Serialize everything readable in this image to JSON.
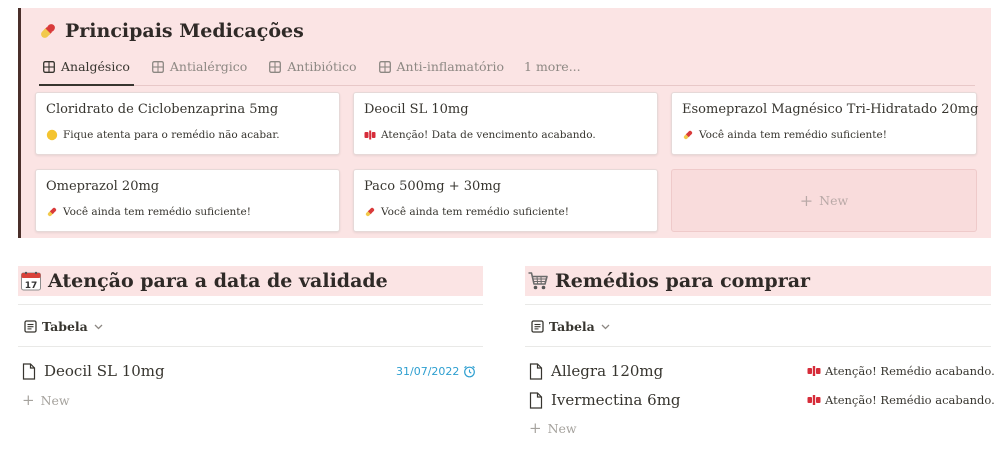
{
  "callout": {
    "title": "Principais Medicações",
    "tabs": [
      {
        "label": "Analgésico",
        "active": true
      },
      {
        "label": "Antialérgico",
        "active": false
      },
      {
        "label": "Antibiótico",
        "active": false
      },
      {
        "label": "Anti-inflamatório",
        "active": false
      }
    ],
    "more_label": "1 more...",
    "cards": [
      {
        "title": "Cloridrato de Ciclobenzaprina 5mg",
        "status": "Fique atenta para o remédio não acabar.",
        "status_icon": "yellow-circle-icon"
      },
      {
        "title": "Deocil SL 10mg",
        "status": "Atenção! Data de vencimento acabando.",
        "status_icon": "red-pills-icon"
      },
      {
        "title": "Esomeprazol Magnésico Tri-Hidratado 20mg",
        "status": "Você ainda tem remédio suficiente!",
        "status_icon": "pill-icon"
      },
      {
        "title": "Omeprazol 20mg",
        "status": "Você ainda tem remédio suficiente!",
        "status_icon": "pill-icon"
      },
      {
        "title": "Paco 500mg + 30mg",
        "status": "Você ainda tem remédio suficiente!",
        "status_icon": "pill-icon"
      }
    ],
    "new_card_label": "New"
  },
  "validade": {
    "title": "Atenção para a data de validade",
    "view_label": "Tabela",
    "rows": [
      {
        "name": "Deocil SL 10mg",
        "date": "31/07/2022"
      }
    ],
    "new_label": "New"
  },
  "comprar": {
    "title": "Remédios para comprar",
    "view_label": "Tabela",
    "rows": [
      {
        "name": "Allegra 120mg",
        "status": "Atenção! Remédio acabando."
      },
      {
        "name": "Ivermectina 6mg",
        "status": "Atenção! Remédio acabando."
      }
    ],
    "new_label": "New"
  },
  "colors": {
    "callout_bg": "#fbe4e4",
    "callout_border": "#4a2f2a",
    "date_blue": "#2e9fd0",
    "text": "#37352f",
    "muted": "#a5a29d"
  }
}
